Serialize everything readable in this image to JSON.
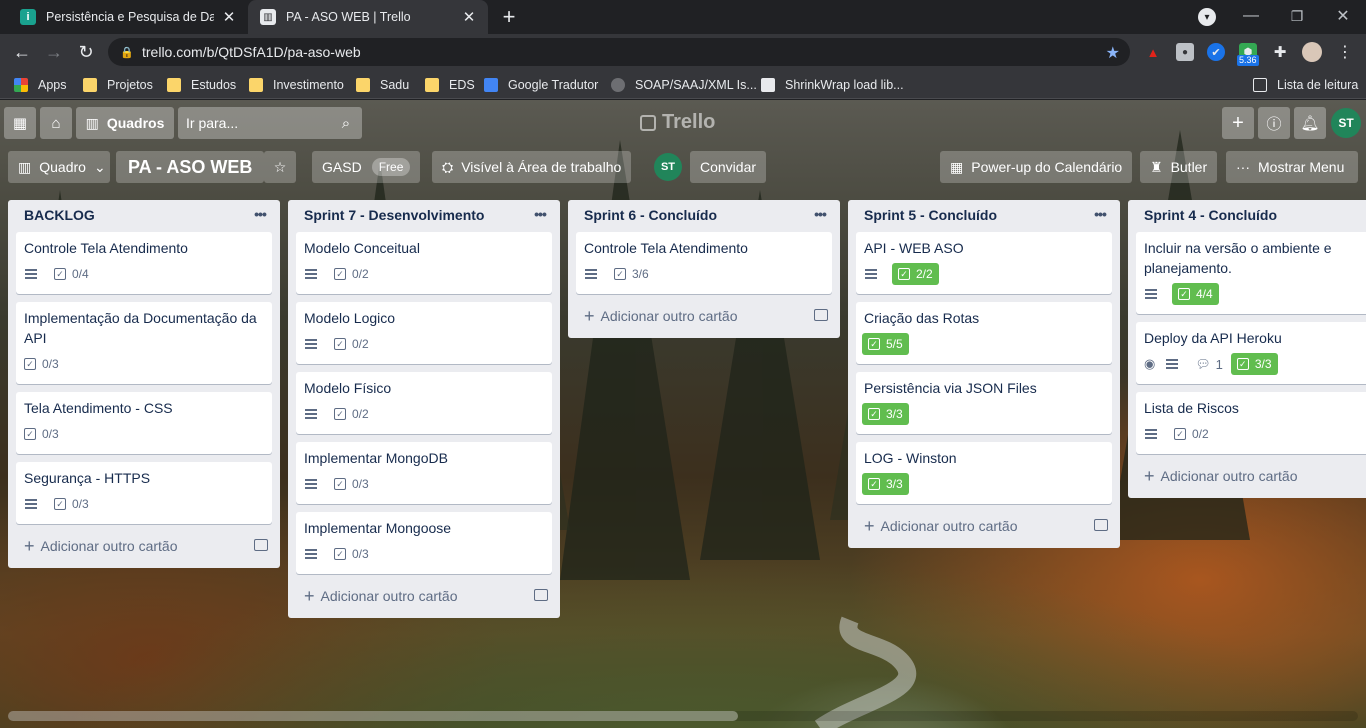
{
  "browser": {
    "tabs": [
      {
        "title": "Persistência e Pesquisa de Dados",
        "favicon_color": "#1aa28f",
        "active": false
      },
      {
        "title": "PA - ASO WEB | Trello",
        "favicon_color": "#e8eaed",
        "active": true
      }
    ],
    "new_tab": "+",
    "window_controls": {
      "minimize": "—",
      "maximize": "❐",
      "close": "✕"
    },
    "url": "trello.com/b/QtDSfA1D/pa-aso-web",
    "ext_badge": "5.36",
    "reading_list": "Lista de leitura",
    "bookmarks": [
      {
        "label": "Apps",
        "icon": "apps-grid-icon"
      },
      {
        "label": "Projetos",
        "icon": "folder-icon"
      },
      {
        "label": "Estudos",
        "icon": "folder-icon"
      },
      {
        "label": "Investimento",
        "icon": "folder-icon"
      },
      {
        "label": "Sadu",
        "icon": "folder-icon"
      },
      {
        "label": "EDS",
        "icon": "folder-icon"
      },
      {
        "label": "Google Tradutor",
        "icon": "google-translate-icon"
      },
      {
        "label": "SOAP/SAAJ/XML Is...",
        "icon": "soap-icon"
      },
      {
        "label": "ShrinkWrap load lib...",
        "icon": "dev-icon"
      }
    ]
  },
  "trello": {
    "header": {
      "boards_label": "Quadros",
      "search_placeholder": "Ir para...",
      "logo": "Trello",
      "user_initials": "ST"
    },
    "board": {
      "view_label": "Quadro",
      "title": "PA - ASO WEB",
      "team": "GASD",
      "team_badge": "Free",
      "visibility": "Visível à Área de trabalho",
      "member_initials": "ST",
      "invite": "Convidar",
      "calendar": "Power-up do Calendário",
      "butler": "Butler",
      "menu": "Mostrar Menu"
    },
    "add_card_label": "Adicionar outro cartão",
    "lists": [
      {
        "title": "BACKLOG",
        "cards": [
          {
            "title": "Controle Tela Atendimento",
            "desc": true,
            "checklist": "0/4",
            "done": false
          },
          {
            "title": "Implementação da Documentação da API",
            "desc": false,
            "checklist": "0/3",
            "done": false
          },
          {
            "title": "Tela Atendimento - CSS",
            "desc": false,
            "checklist": "0/3",
            "done": false
          },
          {
            "title": "Segurança - HTTPS",
            "desc": true,
            "checklist": "0/3",
            "done": false
          }
        ]
      },
      {
        "title": "Sprint 7 - Desenvolvimento",
        "cards": [
          {
            "title": "Modelo Conceitual",
            "desc": true,
            "checklist": "0/2",
            "done": false
          },
          {
            "title": "Modelo Logico",
            "desc": true,
            "checklist": "0/2",
            "done": false
          },
          {
            "title": "Modelo Físico",
            "desc": true,
            "checklist": "0/2",
            "done": false
          },
          {
            "title": "Implementar MongoDB",
            "desc": true,
            "checklist": "0/3",
            "done": false
          },
          {
            "title": "Implementar Mongoose",
            "desc": true,
            "checklist": "0/3",
            "done": false
          }
        ]
      },
      {
        "title": "Sprint 6 - Concluído",
        "cards": [
          {
            "title": "Controle Tela Atendimento",
            "desc": true,
            "checklist": "3/6",
            "done": false
          }
        ]
      },
      {
        "title": "Sprint 5 - Concluído",
        "cards": [
          {
            "title": "API - WEB ASO",
            "desc": true,
            "checklist": "2/2",
            "done": true
          },
          {
            "title": "Criação das Rotas",
            "desc": false,
            "checklist": "5/5",
            "done": true
          },
          {
            "title": "Persistência via JSON Files",
            "desc": false,
            "checklist": "3/3",
            "done": true
          },
          {
            "title": "LOG - Winston",
            "desc": false,
            "checklist": "3/3",
            "done": true
          }
        ]
      },
      {
        "title": "Sprint 4 - Concluído",
        "cards": [
          {
            "title": "Incluir na versão o ambiente e planejamento.",
            "desc": true,
            "checklist": "4/4",
            "done": true
          },
          {
            "title": "Deploy da API Heroku",
            "desc": true,
            "watch": true,
            "comments": "1",
            "checklist": "3/3",
            "done": true
          },
          {
            "title": "Lista de Riscos",
            "desc": true,
            "checklist": "0/2",
            "done": false
          }
        ]
      }
    ]
  }
}
